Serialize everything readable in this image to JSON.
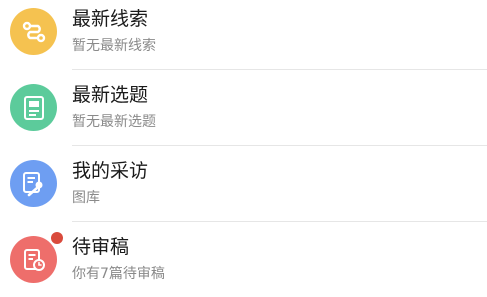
{
  "items": [
    {
      "title": "最新线索",
      "subtitle": "暂无最新线索",
      "icon": "link-icon",
      "color": "#F5C250"
    },
    {
      "title": "最新选题",
      "subtitle": "暂无最新选题",
      "icon": "document-icon",
      "color": "#5CCB9B"
    },
    {
      "title": "我的采访",
      "subtitle": "图库",
      "icon": "interview-icon",
      "color": "#6E9EF2"
    },
    {
      "title": "待审稿",
      "subtitle": "你有7篇待审稿",
      "icon": "review-icon",
      "color": "#EE6E6B",
      "badge_color": "#D94A3C"
    }
  ]
}
